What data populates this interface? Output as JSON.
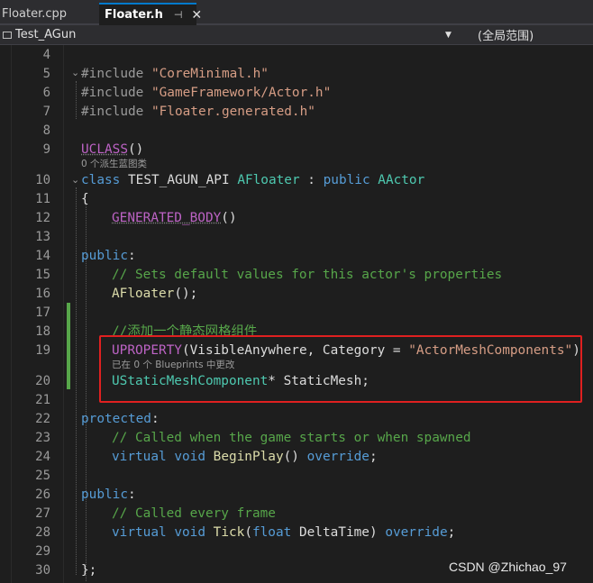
{
  "tabs": [
    {
      "label": "Floater.cpp",
      "active": false
    },
    {
      "label": "Floater.h",
      "active": true,
      "pin": "⊣",
      "close": "✕"
    }
  ],
  "nav": {
    "project": "Test_AGun",
    "scope": "(全局范围)"
  },
  "lines": {
    "n4": "4",
    "n5": "5",
    "n6": "6",
    "n7": "7",
    "n8": "8",
    "n9": "9",
    "n10": "10",
    "n11": "11",
    "n12": "12",
    "n13": "13",
    "n14": "14",
    "n15": "15",
    "n16": "16",
    "n17": "17",
    "n18": "18",
    "n19": "19",
    "n20": "20",
    "n21": "21",
    "n22": "22",
    "n23": "23",
    "n24": "24",
    "n25": "25",
    "n26": "26",
    "n27": "27",
    "n28": "28",
    "n29": "29",
    "n30": "30"
  },
  "code": {
    "inc_kw": "#include",
    "inc1": "\"CoreMinimal.h\"",
    "inc2": "\"GameFramework/Actor.h\"",
    "inc3": "\"Floater.generated.h\"",
    "uclass": "UCLASS",
    "parens": "()",
    "hint_derived": "0 个派生蓝图类",
    "class_kw": "class",
    "api": "TEST_AGUN_API",
    "afloater": "AFloater",
    "colon": " : ",
    "public_kw": "public",
    "aactor": "AActor",
    "open_brace": "{",
    "generated_body": "GENERATED_BODY",
    "public_label": "public",
    "label_colon": ":",
    "comment_defaults": "// Sets default values for this actor's properties",
    "ctor": "AFloater",
    "ctor_tail": "();",
    "comment_mesh": "//添加一个静态网格组件",
    "uproperty": "UPROPERTY",
    "uproperty_args_a": "(VisibleAnywhere, Category = ",
    "uproperty_str": "\"ActorMeshComponents\"",
    "uproperty_close": ")",
    "hint_blueprints": "已在 0 个 Blueprints 中更改",
    "mesh_type": "UStaticMeshComponent",
    "mesh_decl": "* StaticMesh;",
    "protected_label": "protected",
    "comment_begin": "// Called when the game starts or when spawned",
    "virtual_kw": "virtual",
    "void_kw": "void",
    "beginplay": "BeginPlay",
    "call_parens": "()",
    "override_kw": "override",
    "semicolon": ";",
    "comment_tick": "// Called every frame",
    "tick": "Tick",
    "float_kw": "float",
    "deltatime": "DeltaTime",
    "close_brace": "};"
  },
  "watermark": "CSDN @Zhichao_97",
  "colors": {
    "keyword": "#569cd6",
    "string": "#d69d85",
    "comment": "#57a64a",
    "type": "#4ec9b0",
    "macro": "#bd63c5",
    "highlight_box": "#e02020"
  }
}
